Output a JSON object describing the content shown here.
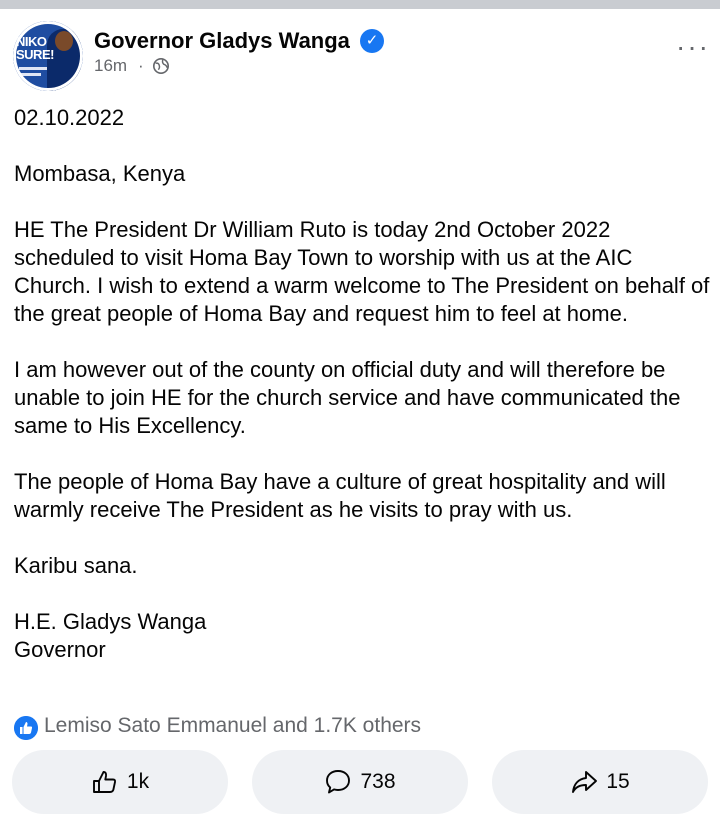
{
  "post": {
    "author": "Governor Gladys Wanga",
    "verified": true,
    "time": "16m",
    "separator": "·",
    "audience_icon": "globe-icon",
    "more_label": "···",
    "avatar_text": "NIKO SURE!",
    "body": [
      "02.10.2022",
      "Mombasa, Kenya",
      "HE The President Dr William Ruto is today 2nd October 2022 scheduled to visit Homa Bay Town to worship with us at the AIC Church. I wish to extend a warm welcome to The President on behalf of the great people of Homa Bay and request him to feel at home.",
      "I am however out of the county on official duty and will therefore be unable to join HE for the church service and have communicated the same to His Excellency.",
      "The people of Homa Bay have a culture of great hospitality and will warmly receive The President as he visits to pray with us.",
      "Karibu sana."
    ],
    "signature": [
      "H.E. Gladys Wanga",
      "Governor"
    ]
  },
  "reactions": {
    "icon": "like-icon",
    "text": "Lemiso Sato Emmanuel and 1.7K others"
  },
  "actions": {
    "like_count": "1k",
    "comment_count": "738",
    "share_count": "15"
  },
  "colors": {
    "accent": "#1877f2",
    "secondary_text": "#65676b",
    "button_bg": "#eff1f4"
  }
}
